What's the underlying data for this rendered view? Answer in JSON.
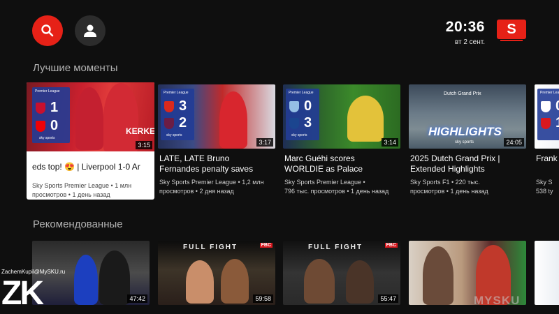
{
  "header": {
    "time": "20:36",
    "date": "вт 2 сент.",
    "logo_letter": "S",
    "accent_color": "#e62117",
    "search_icon": "search-icon",
    "account_icon": "account-icon"
  },
  "sections": [
    {
      "title": "Лучшие моменты"
    },
    {
      "title": "Рекомендованные"
    }
  ],
  "highlights": [
    {
      "title": "eds top! 😍 | Liverpool 1-0 Ar",
      "channel": "Sky Sports Premier League • 1 млн",
      "info": "просмотров • 1 день назад",
      "duration": "3:15",
      "focused": true,
      "score_home": "1",
      "score_away": "0",
      "overlay_text": "KERKEZ"
    },
    {
      "title": "LATE, LATE Bruno Fernandes penalty saves Red Devils' b...",
      "channel": "Sky Sports Premier League • 1,2 млн",
      "info": "просмотров • 2 дня назад",
      "duration": "3:17",
      "score_home": "3",
      "score_away": "2"
    },
    {
      "title": "Marc Guéhi scores WORLDIE as Palace thump...",
      "channel": "Sky Sports Premier League •",
      "info": "796 тыс. просмотров • 1 день назад",
      "duration": "3:14",
      "score_home": "0",
      "score_away": "3"
    },
    {
      "title": "2025 Dutch Grand Prix | Extended Highlights",
      "channel": "Sky Sports F1 • 220 тыс.",
      "info": "просмотров • 1 день назад",
      "duration": "24:05",
      "overlay_text": "HIGHLIGHTS",
      "overlay_small": "Dutch Grand Prix"
    },
    {
      "title": "Frank first F",
      "channel": "Sky S",
      "info": "538 ty",
      "duration": "",
      "score_home": "0",
      "score_away": "1"
    }
  ],
  "recommended": [
    {
      "duration": "47:42"
    },
    {
      "duration": "59:58",
      "banner": "FULL FIGHT"
    },
    {
      "duration": "55:47",
      "banner": "FULL FIGHT"
    },
    {
      "duration": ""
    },
    {
      "duration": ""
    }
  ],
  "brand_labels": {
    "league": "Premier League",
    "sky": "sky sports",
    "fbc": "FBC"
  },
  "watermarks": {
    "site": "ZachemKupil@MySKU.ru",
    "big": "ZK",
    "corner": "MYSKU"
  }
}
